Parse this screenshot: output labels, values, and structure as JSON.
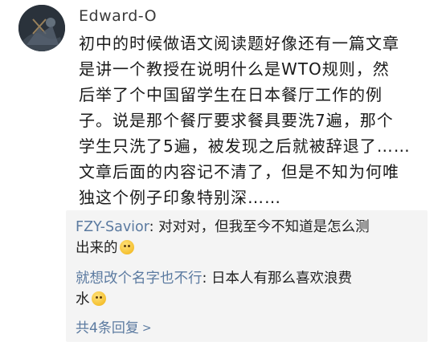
{
  "comment": {
    "username": "Edward-O",
    "avatar_icon": "user-avatar",
    "text_lines": [
      "初中的时候做语文阅读题好像还有一篇文章",
      "是讲一个教授在说明什么是WTO规则，然",
      "后举了个中国留学生在日本餐厅工作的例",
      "子。说是那个餐厅要求餐具要洗7遍，那个",
      "学生只洗了5遍，被发现之后就被辞退了……",
      "文章后面的内容记不清了，但是不知为何唯",
      "独这个例子印象特别深……"
    ]
  },
  "replies": [
    {
      "user": "FZY-Savior",
      "separator": ": ",
      "text_line1": "对对对，但我至今不知道是怎么测",
      "text_line2": "出来的",
      "emoji_icon": "laughing-emoji"
    },
    {
      "user": "就想改个名字也不行",
      "separator": ": ",
      "text_line1": "日本人有那么喜欢浪费",
      "text_line2": "水",
      "emoji_icon": "thinking-emoji"
    }
  ],
  "more_replies_label": "共4条回复",
  "more_replies_icon": "chevron-right-icon",
  "colors": {
    "link": "#5b7aa0",
    "reply_bg": "#f4f4f4"
  }
}
